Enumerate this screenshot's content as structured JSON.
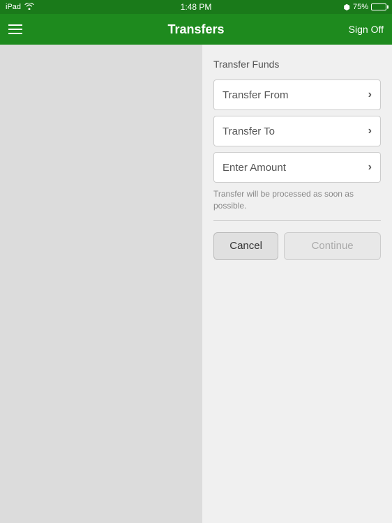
{
  "statusBar": {
    "device": "iPad",
    "wifi": "wifi-icon",
    "time": "1:48 PM",
    "bluetooth": "75%",
    "battery": "75%"
  },
  "navBar": {
    "title": "Transfers",
    "signOff": "Sign Off",
    "menu": "menu-icon"
  },
  "content": {
    "sectionTitle": "Transfer Funds",
    "fields": [
      {
        "label": "Transfer From",
        "chevron": "›"
      },
      {
        "label": "Transfer To",
        "chevron": "›"
      },
      {
        "label": "Enter Amount",
        "chevron": "›"
      }
    ],
    "infoText": "Transfer will be processed as soon as possible.",
    "cancelButton": "Cancel",
    "continueButton": "Continue"
  }
}
